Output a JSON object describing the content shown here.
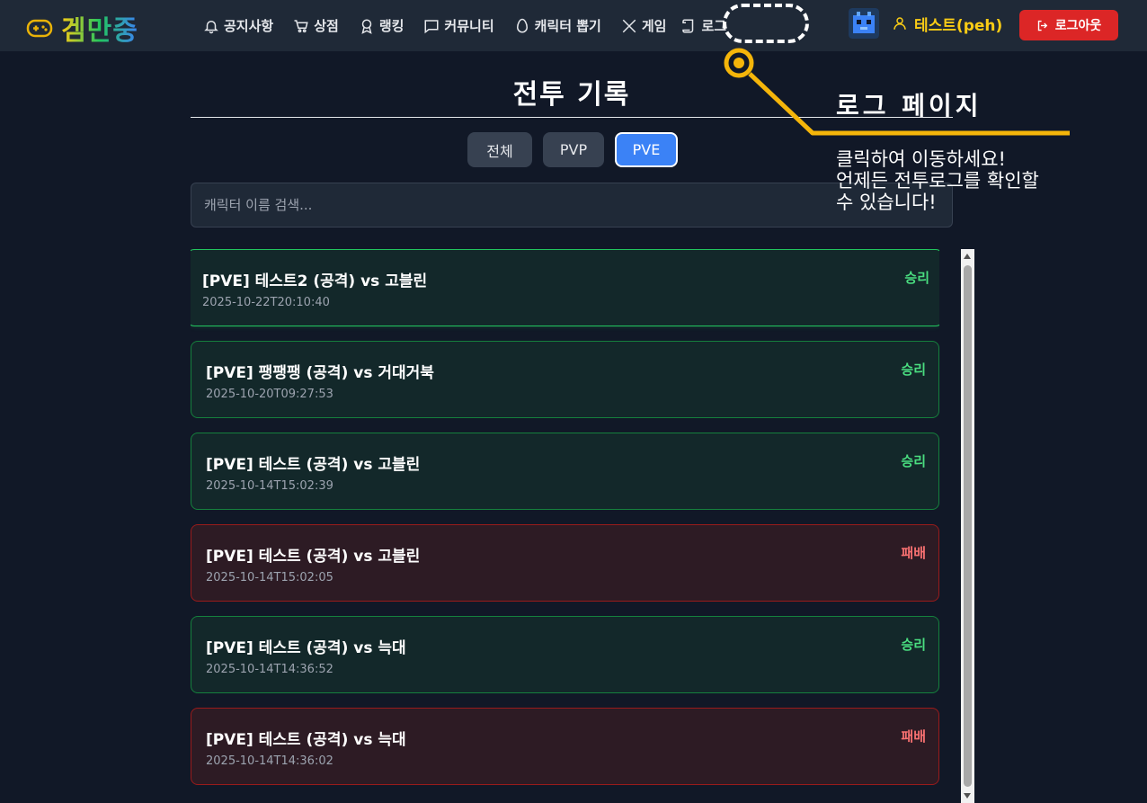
{
  "brand": {
    "name": "겜만중"
  },
  "nav": {
    "items": [
      {
        "label": "공지사항",
        "icon": "bell-icon"
      },
      {
        "label": "상점",
        "icon": "cart-icon"
      },
      {
        "label": "랭킹",
        "icon": "medal-icon"
      },
      {
        "label": "커뮤니티",
        "icon": "chat-icon"
      },
      {
        "label": "캐릭터 뽑기",
        "icon": "egg-icon"
      },
      {
        "label": "게임",
        "icon": "swords-icon"
      },
      {
        "label": "로그",
        "icon": "scroll-icon"
      }
    ],
    "user_name": "테스트(peh)",
    "logout_label": "로그아웃"
  },
  "page": {
    "title": "전투 기록",
    "tabs": [
      {
        "label": "전체",
        "active": false
      },
      {
        "label": "PVP",
        "active": false
      },
      {
        "label": "PVE",
        "active": true
      }
    ],
    "search_placeholder": "캐릭터 이름 검색..."
  },
  "records": [
    {
      "title": "[PVE] 테스트2 (공격) vs 고블린",
      "time": "2025-10-22T20:10:40",
      "result": "승리"
    },
    {
      "title": "[PVE] 팽팽팽 (공격) vs 거대거북",
      "time": "2025-10-20T09:27:53",
      "result": "승리"
    },
    {
      "title": "[PVE] 테스트 (공격) vs 고블린",
      "time": "2025-10-14T15:02:39",
      "result": "승리"
    },
    {
      "title": "[PVE] 테스트 (공격) vs 고블린",
      "time": "2025-10-14T15:02:05",
      "result": "패배"
    },
    {
      "title": "[PVE] 테스트 (공격) vs 늑대",
      "time": "2025-10-14T14:36:52",
      "result": "승리"
    },
    {
      "title": "[PVE] 테스트 (공격) vs 늑대",
      "time": "2025-10-14T14:36:02",
      "result": "패배"
    }
  ],
  "annotation": {
    "title": "로그 페이지",
    "lines": [
      "클릭하여 이동하세요!",
      "언제든 전투로그를 확인할",
      "수 있습니다!"
    ]
  },
  "colors": {
    "accent": "#3b82f6",
    "win": "#4ade80",
    "lose": "#f87171",
    "logout": "#dc2626",
    "user": "#facc15",
    "annotation_line": "#f5b50a"
  }
}
